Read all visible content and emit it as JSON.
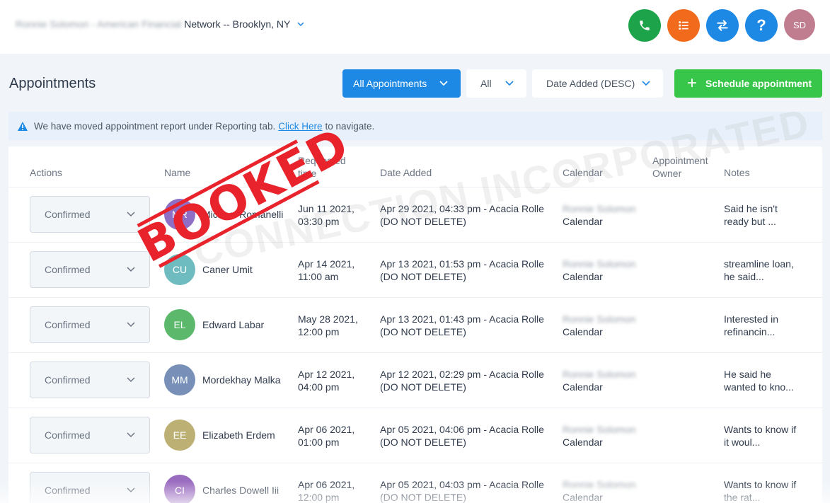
{
  "topbar": {
    "account_blurred": "Ronnie Solomon - American Financial",
    "location": "Network -- Brooklyn, NY",
    "avatar_initials": "SD",
    "help_label": "?"
  },
  "header": {
    "title": "Appointments",
    "filters": {
      "appointments": "All Appointments",
      "scope": "All",
      "sort": "Date Added (DESC)"
    },
    "schedule_label": "Schedule appointment"
  },
  "notice": {
    "before": "We have moved appointment report under Reporting tab.",
    "link": "Click Here",
    "after": "to navigate."
  },
  "table": {
    "headers": {
      "actions": "Actions",
      "name": "Name",
      "requested_1": "Requested",
      "requested_2": "time",
      "date_added": "Date Added",
      "calendar": "Calendar",
      "owner_1": "Appointment",
      "owner_2": "Owner",
      "notes": "Notes"
    },
    "rows": [
      {
        "status": "Confirmed",
        "initials": "MR",
        "color": "#8e6fc5",
        "name": "Michael Romanelli",
        "req_date": "Jun 11 2021,",
        "req_time": "03:30 pm",
        "added_1": "Apr 29 2021, 04:33 pm - Acacia Rolle",
        "added_2": "(DO NOT DELETE)",
        "cal_blur": "Ronnie Solomon",
        "cal": "Calendar",
        "notes_1": "Said he isn't",
        "notes_2": "ready but ..."
      },
      {
        "status": "Confirmed",
        "initials": "CU",
        "color": "#6fbcc0",
        "name": "Caner Umit",
        "req_date": "Apr 14 2021,",
        "req_time": "11:00 am",
        "added_1": "Apr 13 2021, 01:53 pm - Acacia Rolle",
        "added_2": "(DO NOT DELETE)",
        "cal_blur": "Ronnie Solomon",
        "cal": "Calendar",
        "notes_1": "streamline loan,",
        "notes_2": "he said..."
      },
      {
        "status": "Confirmed",
        "initials": "EL",
        "color": "#5cb86a",
        "name": "Edward Labar",
        "req_date": "May 28 2021,",
        "req_time": "12:00 pm",
        "added_1": "Apr 13 2021, 01:43 pm - Acacia Rolle",
        "added_2": "(DO NOT DELETE)",
        "cal_blur": "Ronnie Solomon",
        "cal": "Calendar",
        "notes_1": "Interested in",
        "notes_2": "refinancin..."
      },
      {
        "status": "Confirmed",
        "initials": "MM",
        "color": "#7890b8",
        "name": "Mordekhay Malka",
        "req_date": "Apr 12 2021,",
        "req_time": "04:00 pm",
        "added_1": "Apr 12 2021, 02:29 pm - Acacia Rolle",
        "added_2": "(DO NOT DELETE)",
        "cal_blur": "Ronnie Solomon",
        "cal": "Calendar",
        "notes_1": "He said he",
        "notes_2": "wanted to kno..."
      },
      {
        "status": "Confirmed",
        "initials": "EE",
        "color": "#bdb074",
        "name": "Elizabeth Erdem",
        "req_date": "Apr 06 2021,",
        "req_time": "01:00 pm",
        "added_1": "Apr 05 2021, 04:06 pm - Acacia Rolle",
        "added_2": "(DO NOT DELETE)",
        "cal_blur": "Ronnie Solomon",
        "cal": "Calendar",
        "notes_1": "Wants to know if",
        "notes_2": "it woul..."
      },
      {
        "status": "Confirmed",
        "initials": "CI",
        "color": "#9a6cc0",
        "name": "Charles Dowell Iii",
        "req_date": "Apr 06 2021,",
        "req_time": "12:00 pm",
        "added_1": "Apr 05 2021, 04:03 pm - Acacia Rolle",
        "added_2": "(DO NOT DELETE)",
        "cal_blur": "Ronnie Solomon",
        "cal": "Calendar",
        "notes_1": "Wants to know if",
        "notes_2": "the rat..."
      }
    ]
  },
  "overlay": {
    "watermark": "CONNECTION INCORPORATED",
    "stamp": "BOOKED"
  }
}
